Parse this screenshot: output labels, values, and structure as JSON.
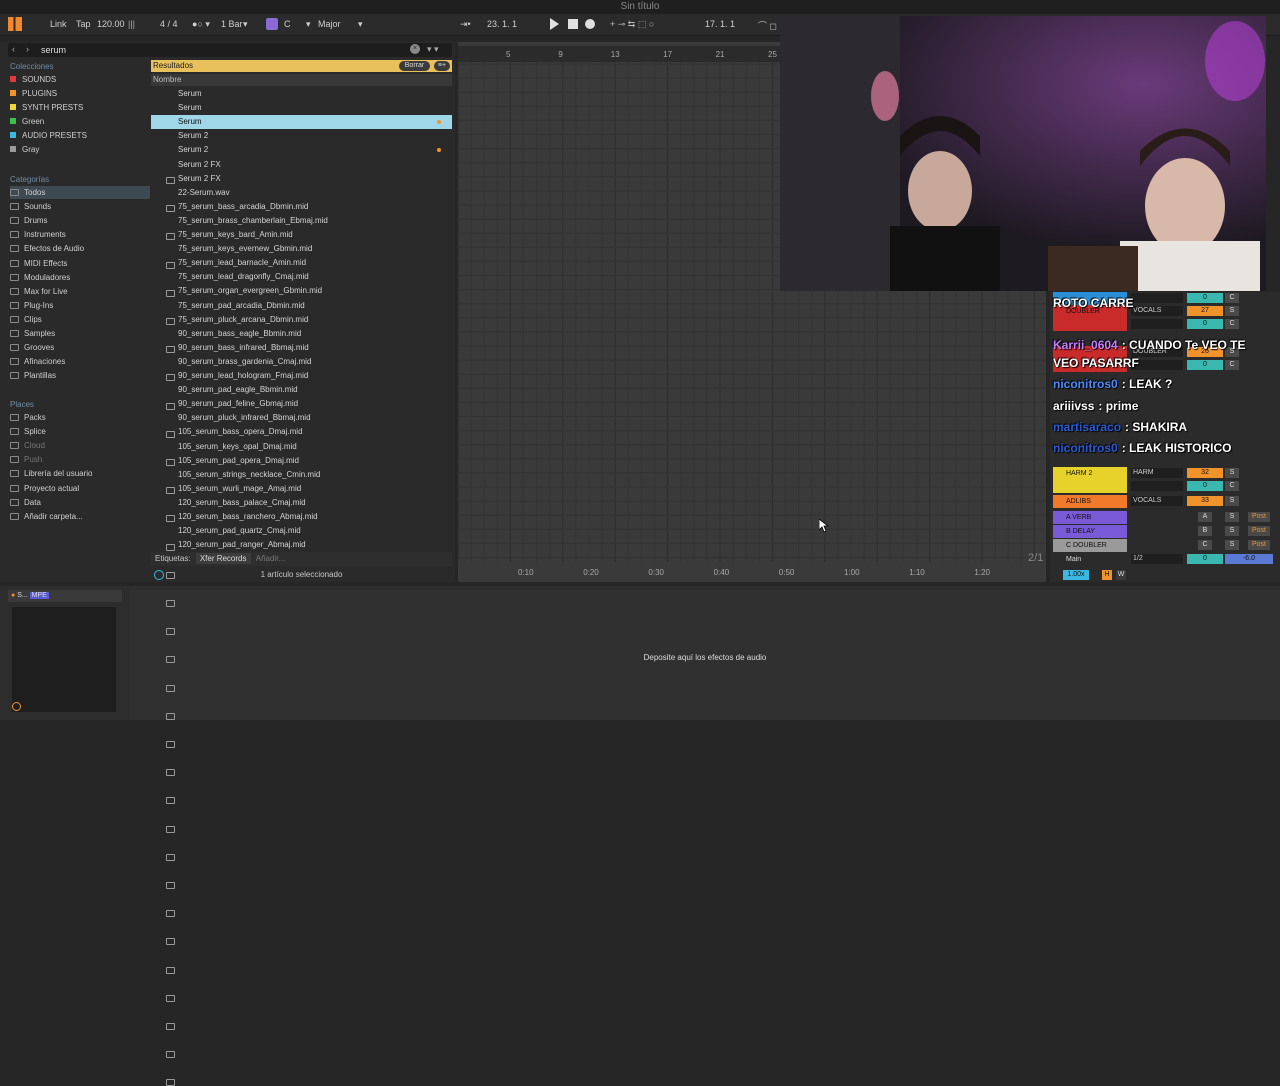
{
  "window_title": "Sin título",
  "transport": {
    "link": "Link",
    "tap": "Tap",
    "tempo": "120.00",
    "time_sig": "4 / 4",
    "quantize": "1 Bar",
    "key": "C",
    "scale": "Major",
    "position": "23.  1.  1",
    "loop_start": "17.  1.  1"
  },
  "browser": {
    "search_value": "serum",
    "collections_heading": "Colecciones",
    "collections": [
      {
        "label": "SOUNDS",
        "color": "#e03a3a"
      },
      {
        "label": "PLUGINS",
        "color": "#f0932b"
      },
      {
        "label": "SYNTH PRESTS",
        "color": "#f2d23a"
      },
      {
        "label": "Green",
        "color": "#3ac24a"
      },
      {
        "label": "AUDIO PRESETS",
        "color": "#3ab8e0"
      },
      {
        "label": "Gray",
        "color": "#9a9a9a"
      }
    ],
    "categories_heading": "Categorías",
    "categories": [
      "Todos",
      "Sounds",
      "Drums",
      "Instruments",
      "Efectos de Audio",
      "MIDI Effects",
      "Moduladores",
      "Max for Live",
      "Plug-Ins",
      "Clips",
      "Samples",
      "Grooves",
      "Afinaciones",
      "Plantillas"
    ],
    "places_heading": "Places",
    "places": [
      "Packs",
      "Splice",
      "Cloud",
      "Push",
      "Librería del usuario",
      "Proyecto actual",
      "Data",
      "Añadir carpeta..."
    ],
    "results_label": "Resultados",
    "clear_label": "Borrar",
    "name_column": "Nombre",
    "results": [
      "Serum",
      "Serum",
      "Serum",
      "Serum 2",
      "Serum 2",
      "Serum 2 FX",
      "Serum 2 FX",
      "22-Serum.wav",
      "75_serum_bass_arcadia_Dbmin.mid",
      "75_serum_brass_chamberlain_Ebmaj.mid",
      "75_serum_keys_bard_Amin.mid",
      "75_serum_keys_evernew_Gbmin.mid",
      "75_serum_lead_barnacle_Amin.mid",
      "75_serum_lead_dragonfly_Cmaj.mid",
      "75_serum_organ_evergreen_Gbmin.mid",
      "75_serum_pad_arcadia_Dbmin.mid",
      "75_serum_pluck_arcana_Dbmin.mid",
      "90_serum_bass_eagle_Bbmin.mid",
      "90_serum_bass_infrared_Bbmaj.mid",
      "90_serum_brass_gardenia_Cmaj.mid",
      "90_serum_lead_hologram_Fmaj.mid",
      "90_serum_pad_eagle_Bbmin.mid",
      "90_serum_pad_feline_Gbmaj.mid",
      "90_serum_pluck_infrared_Bbmaj.mid",
      "105_serum_bass_opera_Dmaj.mid",
      "105_serum_keys_opal_Dmaj.mid",
      "105_serum_pad_opera_Dmaj.mid",
      "105_serum_strings_necklace_Cmin.mid",
      "105_serum_wurli_mage_Amaj.mid",
      "120_serum_bass_palace_Cmaj.mid",
      "120_serum_bass_ranchero_Abmaj.mid",
      "120_serum_pad_quartz_Cmaj.mid",
      "120_serum_pad_ranger_Abmaj.mid"
    ],
    "selected_index": 2,
    "tags_label": "Etiquetas:",
    "tag": "Xfer Records",
    "add_tag": "Añadir...",
    "status": "1 artículo seleccionado"
  },
  "arrangement": {
    "bar_markers": [
      "5",
      "9",
      "13",
      "17",
      "21",
      "25"
    ],
    "time_markers": [
      "0:10",
      "0:20",
      "0:30",
      "0:40",
      "0:50",
      "1:00",
      "1:10",
      "1:20"
    ],
    "page_indicator": "2/1"
  },
  "mixer": {
    "channels": [
      {
        "name": "",
        "input": "",
        "vol": "0",
        "pan": "C",
        "color": "#2a8fd6"
      },
      {
        "name": "DOUBLER",
        "input": "VOCALS",
        "vol": "27",
        "pan": "S",
        "color": "#c92a2a"
      },
      {
        "name": "",
        "input": "",
        "vol": "0",
        "pan": "C",
        "color": "#c92a2a"
      },
      {
        "name": "",
        "input": "DOUBLER",
        "vol": "26",
        "pan": "S",
        "color": "#c92a2a"
      },
      {
        "name": "",
        "input": "",
        "vol": "0",
        "pan": "C",
        "color": "#c92a2a"
      },
      {
        "name": "HARM 2",
        "input": "HARM",
        "vol": "32",
        "pan": "S",
        "color": "#e6d22a"
      },
      {
        "name": "",
        "input": "",
        "vol": "0",
        "pan": "C",
        "color": "#e6d22a"
      },
      {
        "name": "ADLIBS",
        "input": "VOCALS",
        "vol": "33",
        "pan": "S",
        "color": "#f07a2a"
      }
    ],
    "returns": [
      {
        "name": "A VERB",
        "letter": "A",
        "color": "#7a5ad6"
      },
      {
        "name": "B DELAY",
        "letter": "B",
        "color": "#7a5ad6"
      },
      {
        "name": "C DOUBLER",
        "letter": "C",
        "color": "#9a9a9a"
      }
    ],
    "post_label": "Post",
    "main_label": "Main",
    "main_input": "1/2",
    "main_vol": "0",
    "main_db": "-6.0",
    "zoom": "1.00x"
  },
  "chat": [
    {
      "user": "ROTO CARRE",
      "msg": "",
      "color": "#ffffff"
    },
    {
      "user": "Karrii_0604",
      "msg": ": CUANDO Te VEO TE VEO PASARRF",
      "color": "#c77dff"
    },
    {
      "user": "niconitros0",
      "msg": ": LEAK ?",
      "color": "#4a8cff"
    },
    {
      "user": "ariiivss",
      "msg": ": prime",
      "color": "#ffffff"
    },
    {
      "user": "martisaraco",
      "msg": ": SHAKIRA",
      "color": "#2a5ad6"
    },
    {
      "user": "niconitros0",
      "msg": ": LEAK HISTORICO",
      "color": "#2a5ad6"
    }
  ],
  "device_drop": "Deposite aquí los efectos de audio",
  "device_title": "S...",
  "device_mpe": "MPE"
}
